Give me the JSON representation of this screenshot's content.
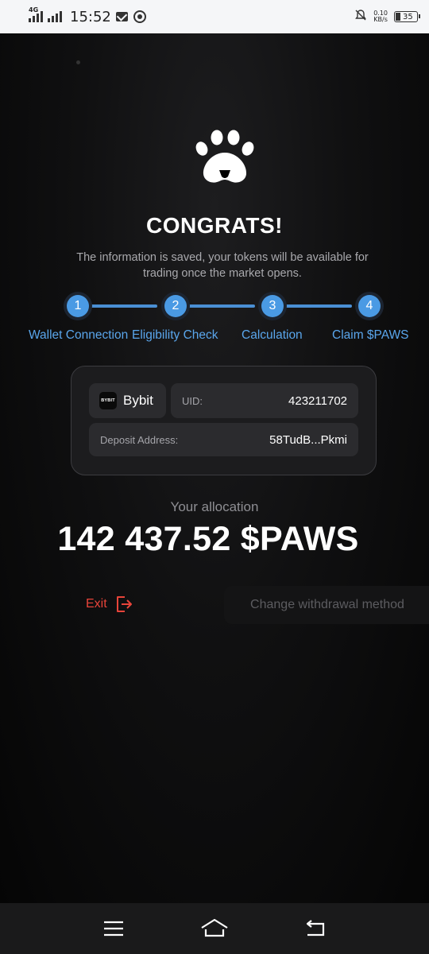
{
  "status_bar": {
    "network": "4G",
    "time": "15:52",
    "speed_value": "0.10",
    "speed_unit": "KB/s",
    "battery": "35"
  },
  "header": {
    "title": "CONGRATS!",
    "subtitle": "The information is saved, your tokens will be available for trading once the market opens."
  },
  "steps": [
    {
      "number": "1",
      "label": "Wallet Connection"
    },
    {
      "number": "2",
      "label": "Eligibility Check"
    },
    {
      "number": "3",
      "label": "Calculation"
    },
    {
      "number": "4",
      "label": "Claim $PAWS"
    }
  ],
  "wallet_card": {
    "exchange_icon_text": "BYBIT",
    "exchange_name": "Bybit",
    "uid_label": "UID:",
    "uid_value": "423211702",
    "deposit_label": "Deposit Address:",
    "deposit_value": "58TudB...Pkmi"
  },
  "allocation": {
    "label": "Your allocation",
    "value": "142 437.52 $PAWS"
  },
  "actions": {
    "exit_label": "Exit",
    "change_label": "Change withdrawal method"
  },
  "colors": {
    "accent_blue": "#4a9ae4",
    "exit_red": "#e8443a"
  },
  "icons": {
    "logo": "paw-icon",
    "exit": "logout-icon",
    "nav_menu": "menu-icon",
    "nav_home": "home-icon",
    "nav_back": "back-icon"
  }
}
